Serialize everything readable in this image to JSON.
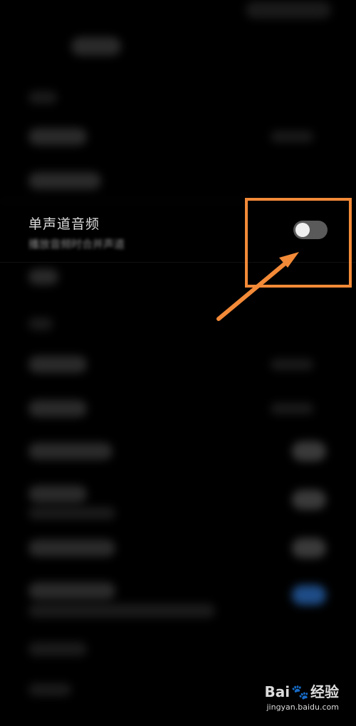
{
  "setting": {
    "title": "单声道音频",
    "subtitle": "播放音频时合并声道",
    "toggle_state": "off"
  },
  "annotation": {
    "highlight_color": "#f38a38"
  },
  "watermark": {
    "brand_left": "Bai",
    "brand_right": "经验",
    "url": "jingyan.baidu.com"
  }
}
